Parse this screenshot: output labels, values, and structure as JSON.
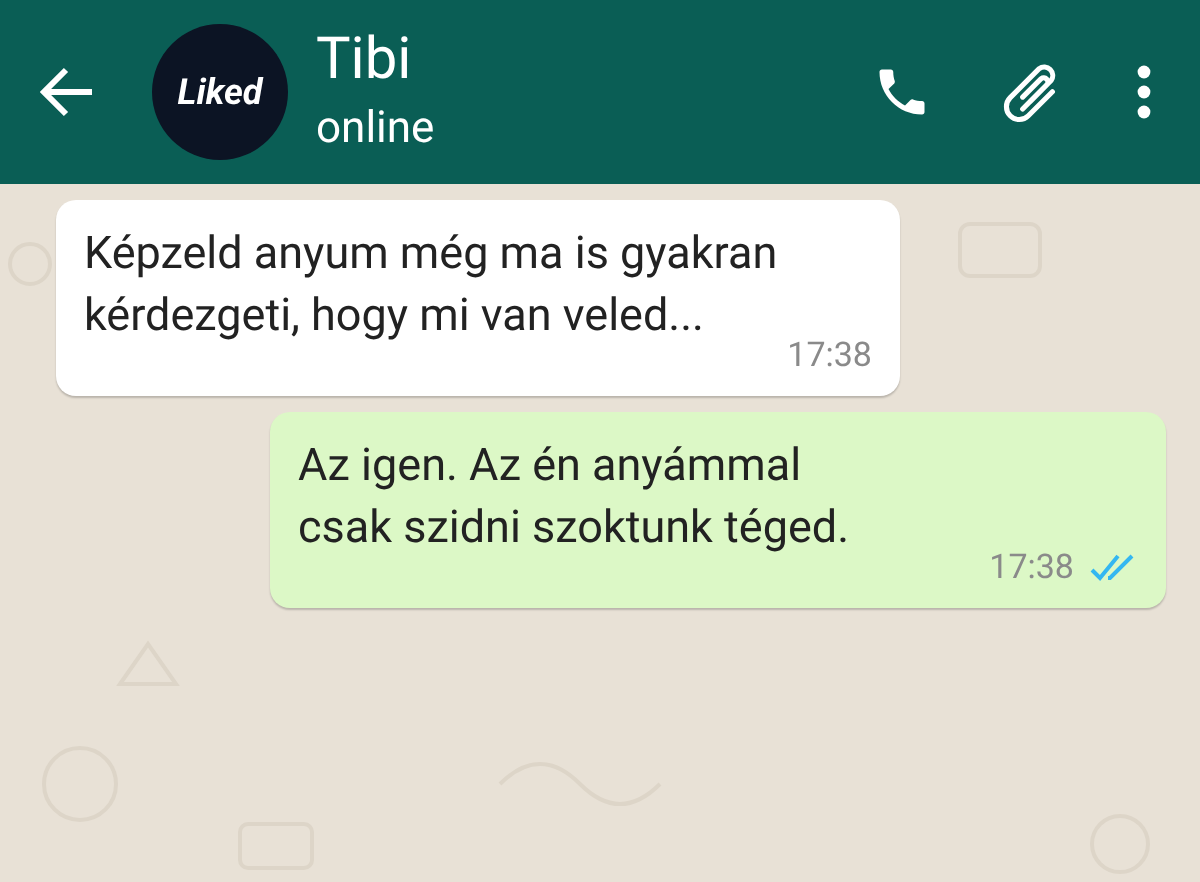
{
  "header": {
    "avatar_text": "Liked",
    "name": "Tibi",
    "status": "online"
  },
  "messages": [
    {
      "outgoing": false,
      "text": "Képzeld anyum még ma is gyakran kérdezgeti, hogy mi van veled...",
      "time": "17:38"
    },
    {
      "outgoing": true,
      "text": "Az igen. Az én anyámmal csak szidni szoktunk téged.",
      "time": "17:38",
      "read": true
    }
  ]
}
